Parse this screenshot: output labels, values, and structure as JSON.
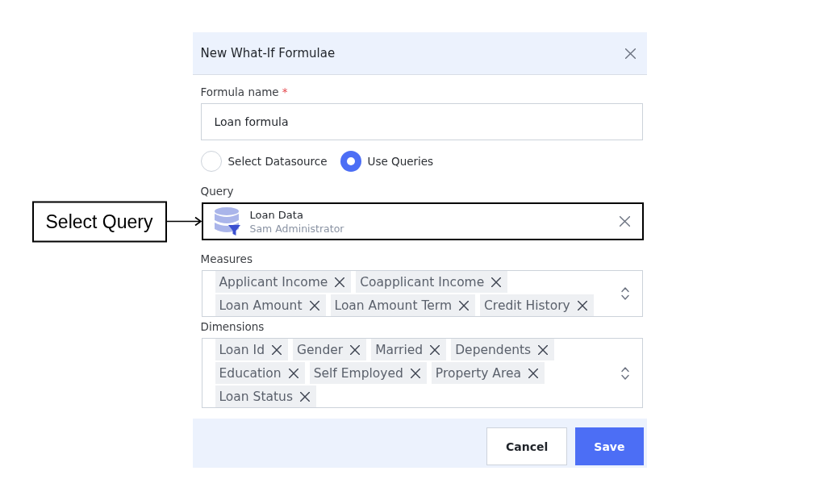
{
  "dialog": {
    "title": "New What-If Formulae"
  },
  "form": {
    "formula_name": {
      "label": "Formula name",
      "required_mark": "*",
      "value": "Loan formula"
    },
    "source_options": [
      {
        "label": "Select Datasource",
        "selected": false
      },
      {
        "label": "Use Queries",
        "selected": true
      }
    ],
    "query": {
      "label": "Query",
      "name": "Loan Data",
      "owner": "Sam Administrator"
    },
    "measures": {
      "label": "Measures",
      "tags": [
        "Applicant Income",
        "Coapplicant Income",
        "Loan Amount",
        "Loan Amount Term",
        "Credit History"
      ]
    },
    "dimensions": {
      "label": "Dimensions",
      "tags": [
        "Loan Id",
        "Gender",
        "Married",
        "Dependents",
        "Education",
        "Self Employed",
        "Property Area",
        "Loan Status"
      ]
    }
  },
  "annotation": {
    "text": "Select Query"
  },
  "buttons": [
    {
      "label": "Cancel",
      "kind": "secondary"
    },
    {
      "label": "Save",
      "kind": "primary"
    }
  ]
}
